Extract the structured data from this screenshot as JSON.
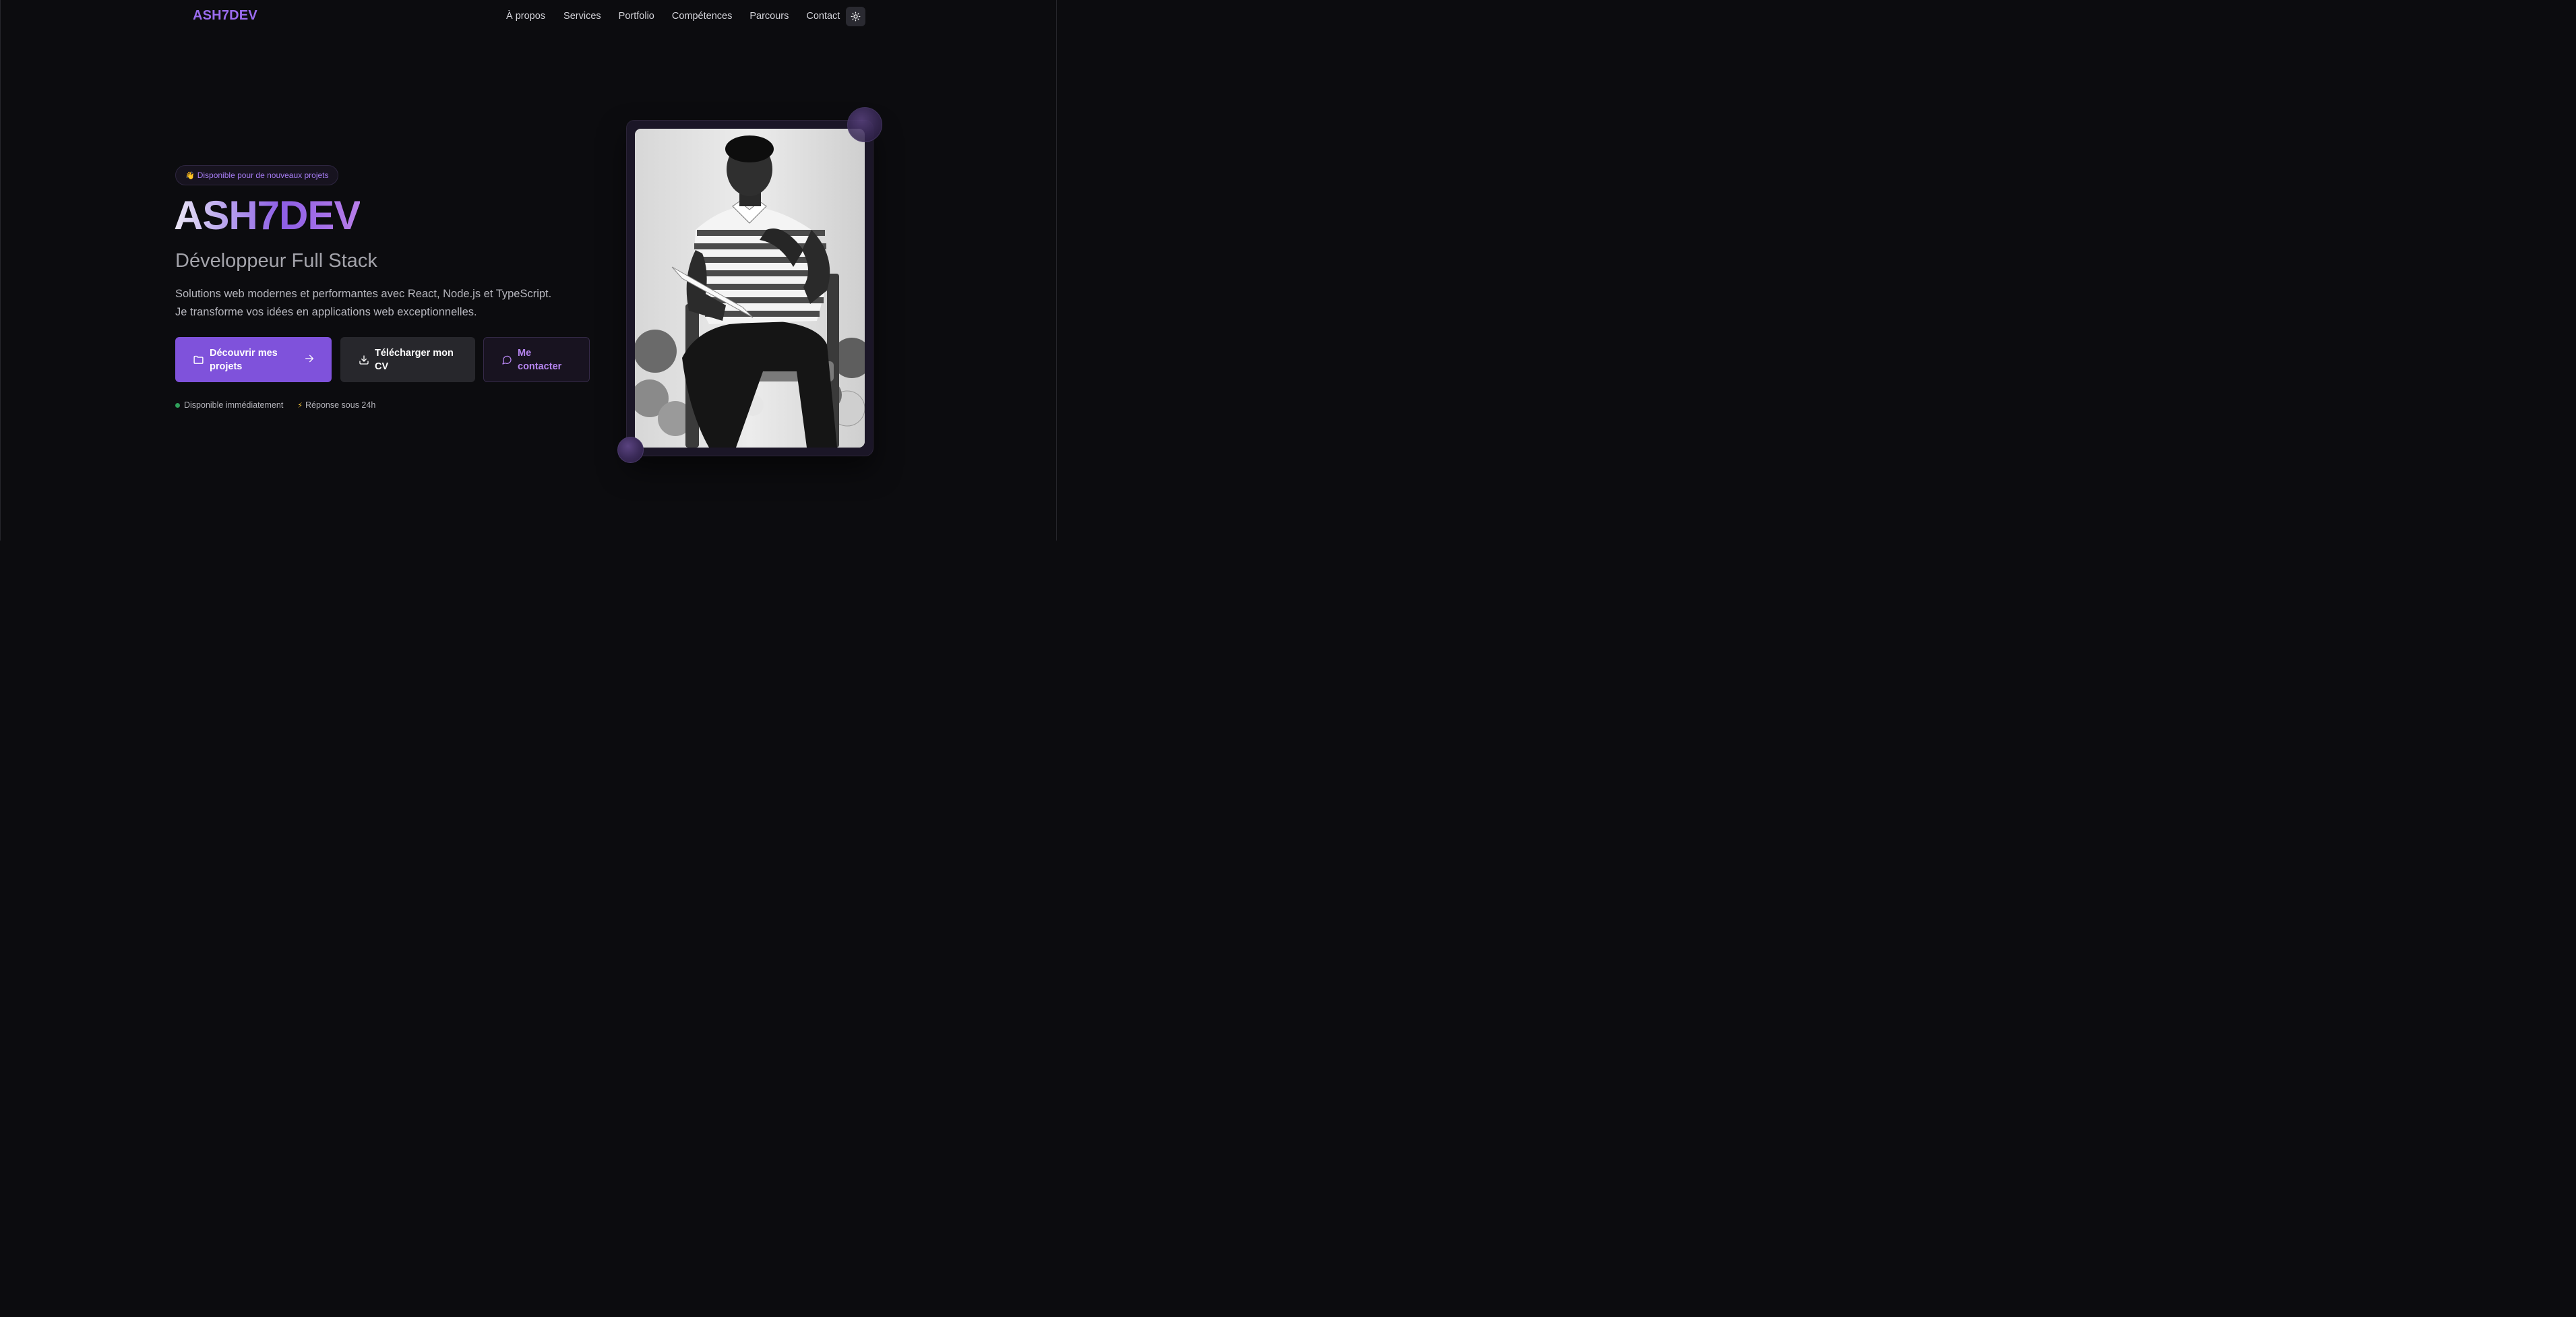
{
  "header": {
    "logo": "ASH7DEV",
    "nav": [
      "À propos",
      "Services",
      "Portfolio",
      "Compétences",
      "Parcours",
      "Contact"
    ],
    "theme_toggle_icon": "sun-icon"
  },
  "hero": {
    "badge_emoji": "👋",
    "badge_text": "Disponible pour de nouveaux projets",
    "title": "ASH7DEV",
    "subtitle": "Développeur Full Stack",
    "description_line1": "Solutions web modernes et performantes avec React, Node.js et TypeScript.",
    "description_line2": "Je transforme vos idées en applications web exceptionnelles.",
    "buttons": {
      "projects": "Découvrir mes projets",
      "cv": "Télécharger mon CV",
      "contact": "Me contacter"
    },
    "status": {
      "available": "Disponible immédiatement",
      "bolt": "⚡",
      "response": "Réponse sous 24h"
    }
  },
  "colors": {
    "accent": "#7f52db",
    "accent_text": "#9b6cf0",
    "background": "#0c0c0f",
    "status_green": "#2fa05a"
  },
  "icons": {
    "projects_button": "folder-icon",
    "projects_arrow": "arrow-right-icon",
    "cv_button": "download-icon",
    "contact_button": "message-circle-icon"
  }
}
